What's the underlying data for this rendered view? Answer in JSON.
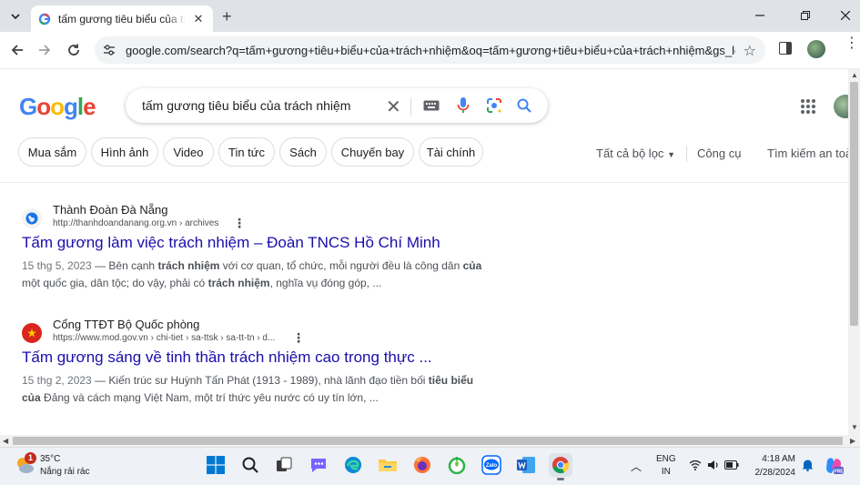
{
  "browser": {
    "tab": {
      "title": "tấm gương tiêu biểu của trách nhiệm - Tìm trên Google",
      "close_icon": "close-icon"
    },
    "url": "google.com/search?q=tấm+gương+tiêu+biểu+của+trách+nhiệm&oq=tấm+gương+tiêu+biểu+của+trách+nhiệm&gs_lcrp=..."
  },
  "search": {
    "logo": "Google",
    "query": "tấm gương tiêu biểu của trách nhiệm"
  },
  "chips": [
    "Mua sắm",
    "Hình ảnh",
    "Video",
    "Tin tức",
    "Sách",
    "Chuyến bay",
    "Tài chính"
  ],
  "filters": {
    "all_filters": "Tất cả bộ lọc",
    "tools": "Công cụ",
    "safe_search": "Tìm kiếm an toàn"
  },
  "results": [
    {
      "site": "Thành Đoàn Đà Nẵng",
      "url": "http://thanhdoandanang.org.vn › archives",
      "title": "Tấm gương làm việc trách nhiệm – Đoàn TNCS Hồ Chí Minh",
      "date": "15 thg 5, 2023",
      "snippet_parts": [
        {
          "text": " — Bên cạnh ",
          "bold": false
        },
        {
          "text": "trách nhiệm",
          "bold": true
        },
        {
          "text": " với cơ quan, tổ chức, mỗi người đều là công dân ",
          "bold": false
        },
        {
          "text": "của",
          "bold": true
        },
        {
          "text": " một quốc gia, dân tộc; do vậy, phải có ",
          "bold": false
        },
        {
          "text": "trách nhiệm",
          "bold": true
        },
        {
          "text": ", nghĩa vụ đóng góp, ...",
          "bold": false
        }
      ]
    },
    {
      "site": "Cổng TTĐT Bộ Quốc phòng",
      "url": "https://www.mod.gov.vn › chi-tiet › sa-ttsk › sa-tt-tn › d...",
      "title": "Tấm gương sáng về tinh thần trách nhiệm cao trong thực ...",
      "date": "15 thg 2, 2023",
      "snippet_parts": [
        {
          "text": " — Kiến trúc sư Huỳnh Tấn Phát (1913 - 1989), nhà lãnh đạo tiền bối ",
          "bold": false
        },
        {
          "text": "tiêu biểu",
          "bold": true
        },
        {
          "text": " ",
          "bold": false
        },
        {
          "text": "của",
          "bold": true
        },
        {
          "text": " Đảng và cách mạng Việt Nam, một trí thức yêu nước có uy tín lớn, ...",
          "bold": false
        }
      ]
    }
  ],
  "taskbar": {
    "weather": {
      "badge": "1",
      "temp": "35°C",
      "desc": "Nắng rải rác"
    },
    "apps": [
      "start",
      "search",
      "task-view",
      "chat",
      "edge",
      "file-explorer",
      "firefox",
      "coccoc",
      "zalo",
      "word",
      "chrome"
    ],
    "lang_line1": "ENG",
    "lang_line2": "IN",
    "time": "4:18 AM",
    "date": "2/28/2024"
  },
  "colors": {
    "link": "#1a0dab",
    "text": "#202124",
    "muted": "#4d5156",
    "tab_strip": "#dfe3e7",
    "google_blue": "#4285f4",
    "google_red": "#ea4335",
    "google_yellow": "#fbbc05",
    "google_green": "#34a853"
  }
}
